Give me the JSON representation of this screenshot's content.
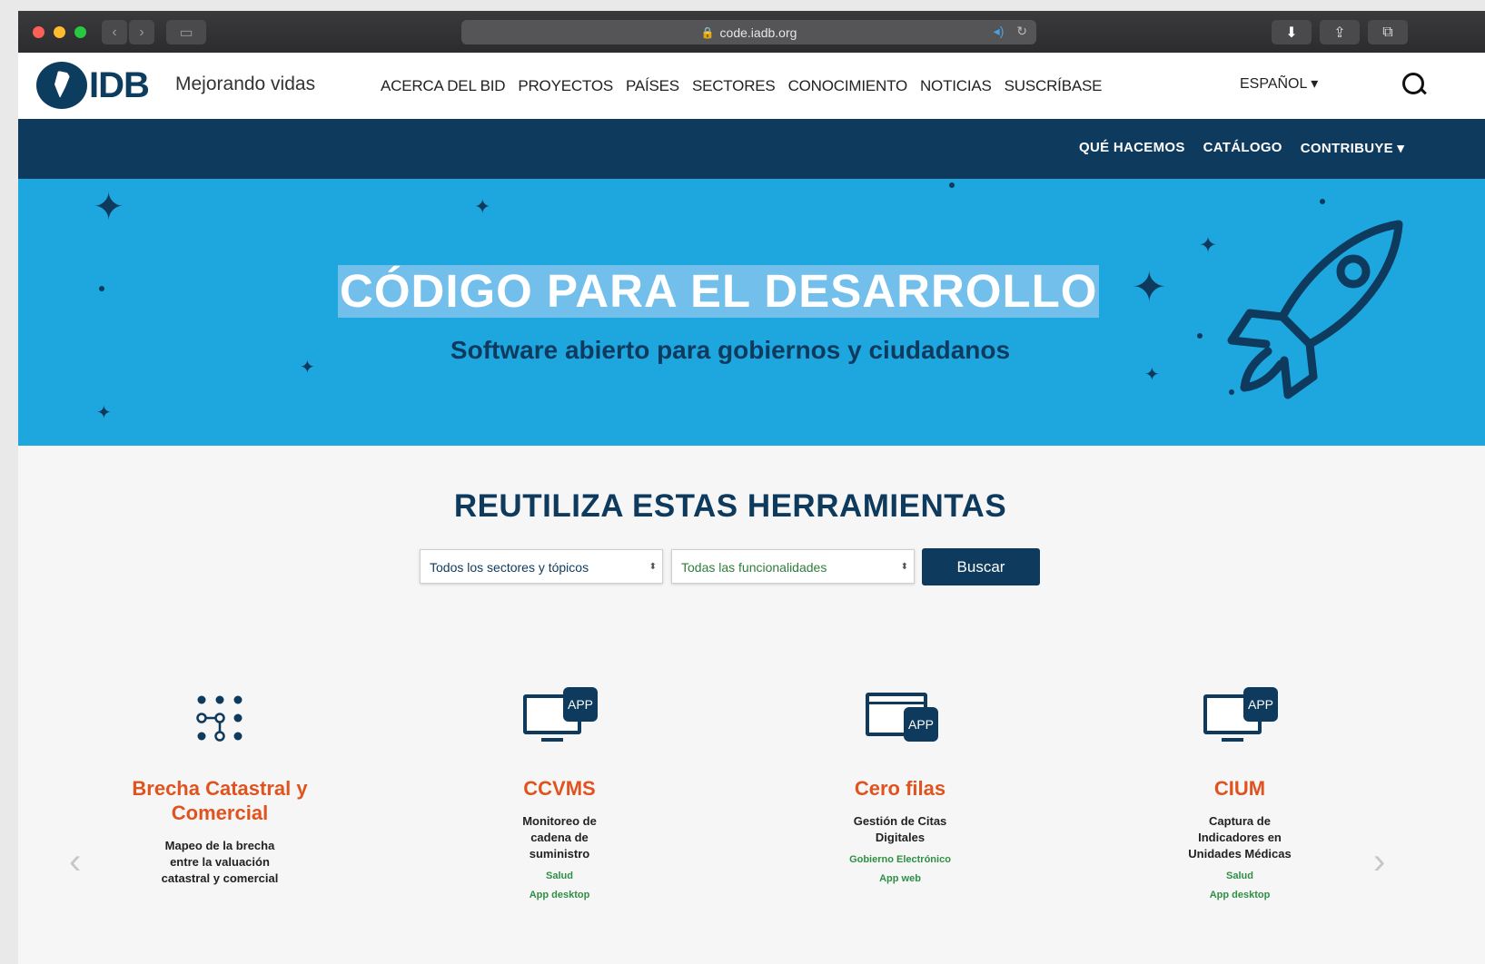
{
  "browser": {
    "url": "code.iadb.org"
  },
  "header": {
    "logo_text": "IDB",
    "tagline": "Mejorando vidas",
    "nav": [
      "ACERCA DEL BID",
      "PROYECTOS",
      "PAÍSES",
      "SECTORES",
      "CONOCIMIENTO",
      "NOTICIAS",
      "SUSCRÍBASE"
    ],
    "language": "ESPAÑOL ▾"
  },
  "subnav": {
    "items": [
      "QUÉ HACEMOS",
      "CATÁLOGO",
      "CONTRIBUYE ▾"
    ]
  },
  "hero": {
    "title": "CÓDIGO PARA EL DESARROLLO",
    "subtitle": "Software abierto para gobiernos y ciudadanos"
  },
  "tools": {
    "title": "REUTILIZA ESTAS HERRAMIENTAS",
    "sector_select": "Todos los sectores y tópicos",
    "function_select": "Todas las funcionalidades",
    "search_button": "Buscar"
  },
  "cards": [
    {
      "title": "Brecha Catastral y Comercial",
      "description": "Mapeo de la brecha entre la valuación catastral y comercial",
      "icon": "network-icon"
    },
    {
      "title": "CCVMS",
      "description": "Monitoreo de cadena de suministro",
      "sector": "Salud",
      "type": "App desktop",
      "icon": "desktop-app-icon"
    },
    {
      "title": "Cero filas",
      "description": "Gestión de Citas Digitales",
      "sector": "Gobierno Electrónico",
      "type": "App web",
      "icon": "web-app-icon"
    },
    {
      "title": "CIUM",
      "description": "Captura de Indicadores en Unidades Médicas",
      "sector": "Salud",
      "type": "App desktop",
      "icon": "desktop-app-icon"
    }
  ],
  "colors": {
    "navy": "#0d3a5d",
    "hero_blue": "#1ea6df",
    "accent_orange": "#e1531e",
    "tag_green": "#2f8f44"
  }
}
